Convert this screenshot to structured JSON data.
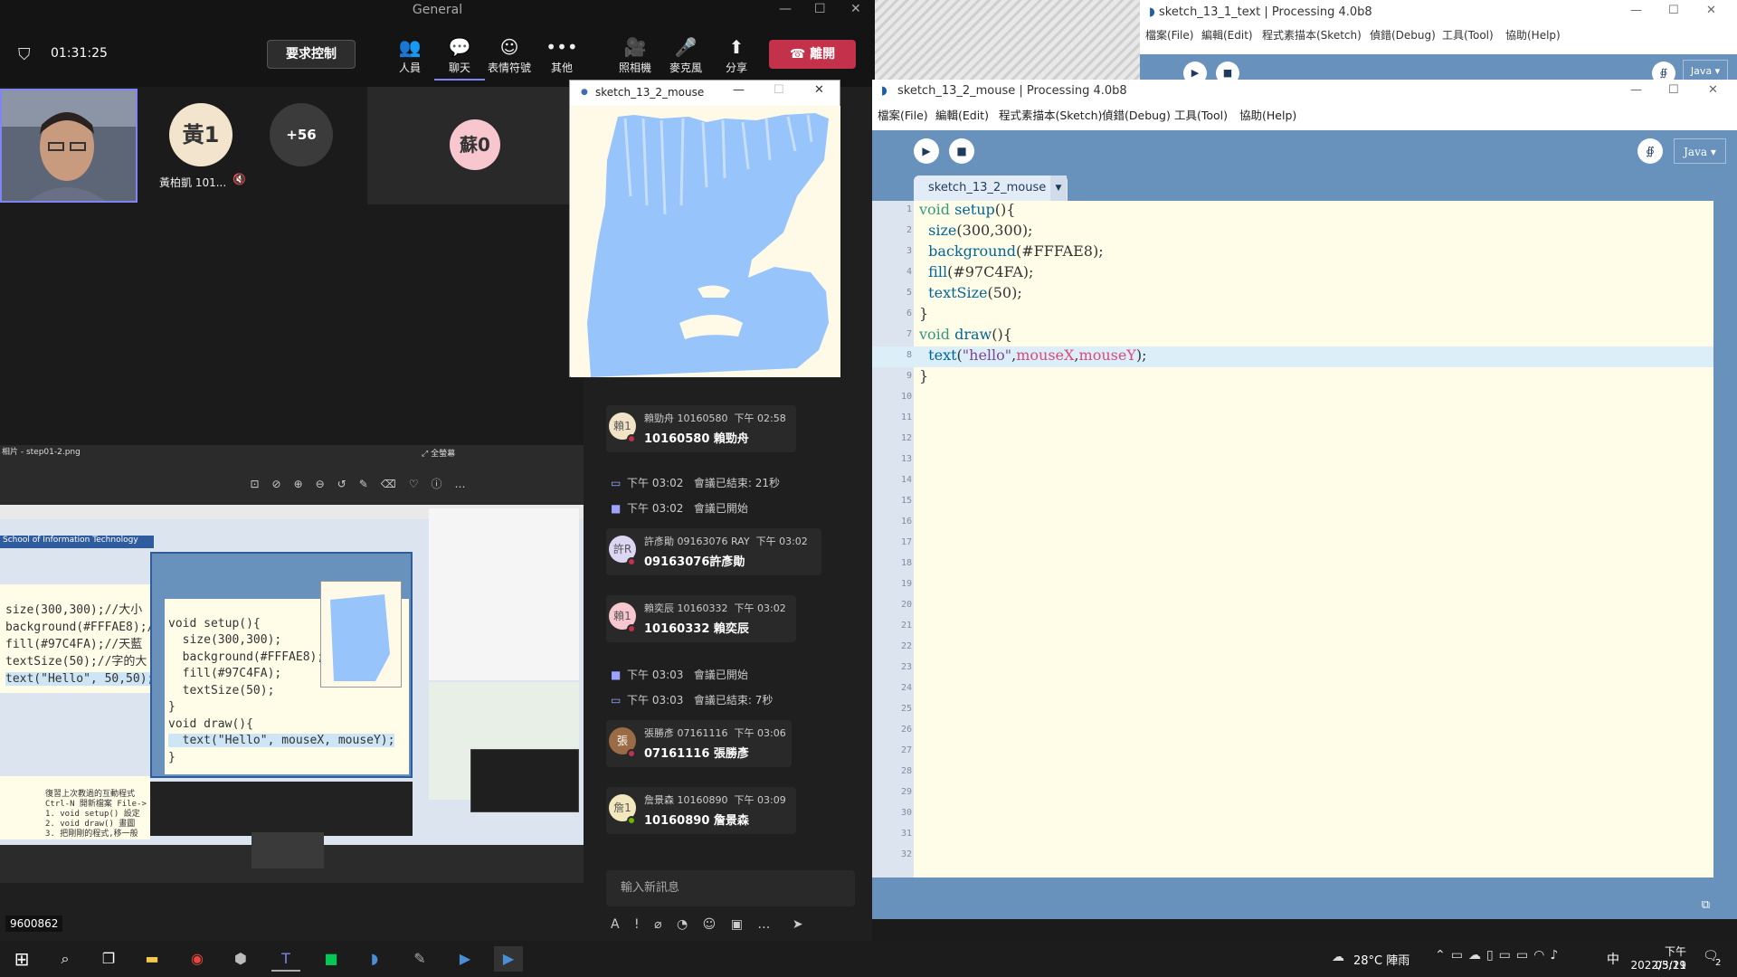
{
  "teams": {
    "title": "General",
    "timer": "01:31:25",
    "request_control": "要求控制",
    "buttons": {
      "people": "人員",
      "chat": "聊天",
      "reactions": "表情符號",
      "more": "其他",
      "camera": "照相機",
      "mic": "麥克風",
      "share": "分享",
      "leave": "離開"
    },
    "participants": {
      "p1_initial": "黃1",
      "p1_name": "黃柏凱 101...",
      "overflow": "+56",
      "p2_initial": "蘇0"
    },
    "viewer_title": "相片 - step01-2.png",
    "viewer_fullscreen": "全螢幕",
    "screen_code_left": [
      "size(300,300);//大小",
      "background(#FFFAE8);/",
      "fill(#97C4FA);//天藍",
      "textSize(50);//字的大",
      "text(\"Hello\", 50,50);"
    ],
    "screen_code_mid": [
      "void setup(){",
      "  size(300,300);",
      "  background(#FFFAE8);",
      "  fill(#97C4FA);",
      "  textSize(50);",
      "}",
      "void draw(){",
      "  text(\"Hello\", mouseX, mouseY);",
      "}"
    ],
    "screen_banner": "School of Information Technology",
    "screen_notes": [
      "復習上次教過的互動程式",
      "Ctrl-N 開新檔案 File->",
      "1. void setup() 設定",
      "2. void draw() 畫圖",
      "3. 把剛剛的程式,移一般"
    ],
    "presenter_id": "9600862"
  },
  "chat": {
    "messages": [
      {
        "initial": "賴1",
        "header": "賴勁舟 10160580",
        "time": "下午 02:58",
        "text": "10160580 賴勁舟"
      },
      {
        "initial": "許R",
        "header": "許彥勛 09163076 RAY",
        "time": "下午 03:02",
        "text": "09163076許彥勛"
      },
      {
        "initial": "賴1",
        "header": "賴奕辰 10160332",
        "time": "下午 03:02",
        "text": "10160332 賴奕辰"
      },
      {
        "initial": "張",
        "header": "張勝彥 07161116",
        "time": "下午 03:06",
        "text": "07161116 張勝彥"
      },
      {
        "initial": "詹1",
        "header": "詹景森 10160890",
        "time": "下午 03:09",
        "text": "10160890 詹景森"
      }
    ],
    "events": [
      {
        "time": "下午 03:02",
        "text": "會議已結束: 21秒"
      },
      {
        "time": "下午 03:02",
        "text": "會議已開始"
      },
      {
        "time": "下午 03:03",
        "text": "會議已開始"
      },
      {
        "time": "下午 03:03",
        "text": "會議已結束: 7秒"
      }
    ],
    "compose_placeholder": "輸入新訊息"
  },
  "processing_bg": {
    "title": "sketch_13_1_text | Processing 4.0b8",
    "menu": [
      "檔案(File)",
      "編輯(Edit)",
      "程式素描本(Sketch)",
      "偵錯(Debug)",
      "工具(Tool)",
      "協助(Help)"
    ],
    "mode": "Java ▾"
  },
  "processing": {
    "title": "sketch_13_2_mouse | Processing 4.0b8",
    "menu": [
      "檔案(File)",
      "編輯(Edit)",
      "程式素描本(Sketch)",
      "偵錯(Debug)",
      "工具(Tool)",
      "協助(Help)"
    ],
    "mode": "Java ▾",
    "tab": "sketch_13_2_mouse",
    "line_numbers": [
      "1",
      "2",
      "3",
      "4",
      "5",
      "6",
      "7",
      "8",
      "9",
      "10",
      "11",
      "12",
      "13",
      "14",
      "15",
      "16",
      "17",
      "18",
      "19",
      "20",
      "21",
      "22",
      "23",
      "24",
      "25",
      "26",
      "27",
      "28",
      "29",
      "30",
      "31",
      "32"
    ],
    "code": {
      "l1_kw": "void",
      "l1_fn": "setup",
      "l1_rest": "(){",
      "l2_fn": "size",
      "l2_rest": "(300,300);",
      "l3_fn": "background",
      "l3_rest": "(#FFFAE8);",
      "l4_fn": "fill",
      "l4_rest": "(#97C4FA);",
      "l5_fn": "textSize",
      "l5_rest": "(50);",
      "l6": "}",
      "l7_kw": "void",
      "l7_fn": "draw",
      "l7_rest": "(){",
      "l8_fn": "text",
      "l8_p1": "(",
      "l8_str": "\"hello\"",
      "l8_c1": ",",
      "l8_v1": "mouseX",
      "l8_c2": ",",
      "l8_v2": "mouseY",
      "l8_end": ");",
      "l9": "}"
    },
    "colors": {
      "toolbar": "#6891bc",
      "editor_bg": "#fffde8",
      "sketch_bg": "#FFFAE8",
      "fill": "#97C4FA"
    }
  },
  "sketch_window": {
    "title": "sketch_13_2_mouse"
  },
  "taskbar": {
    "weather": "28°C 陣雨",
    "ime": "中",
    "time": "下午 03:21",
    "date": "2022/5/19",
    "notifications": "2"
  }
}
